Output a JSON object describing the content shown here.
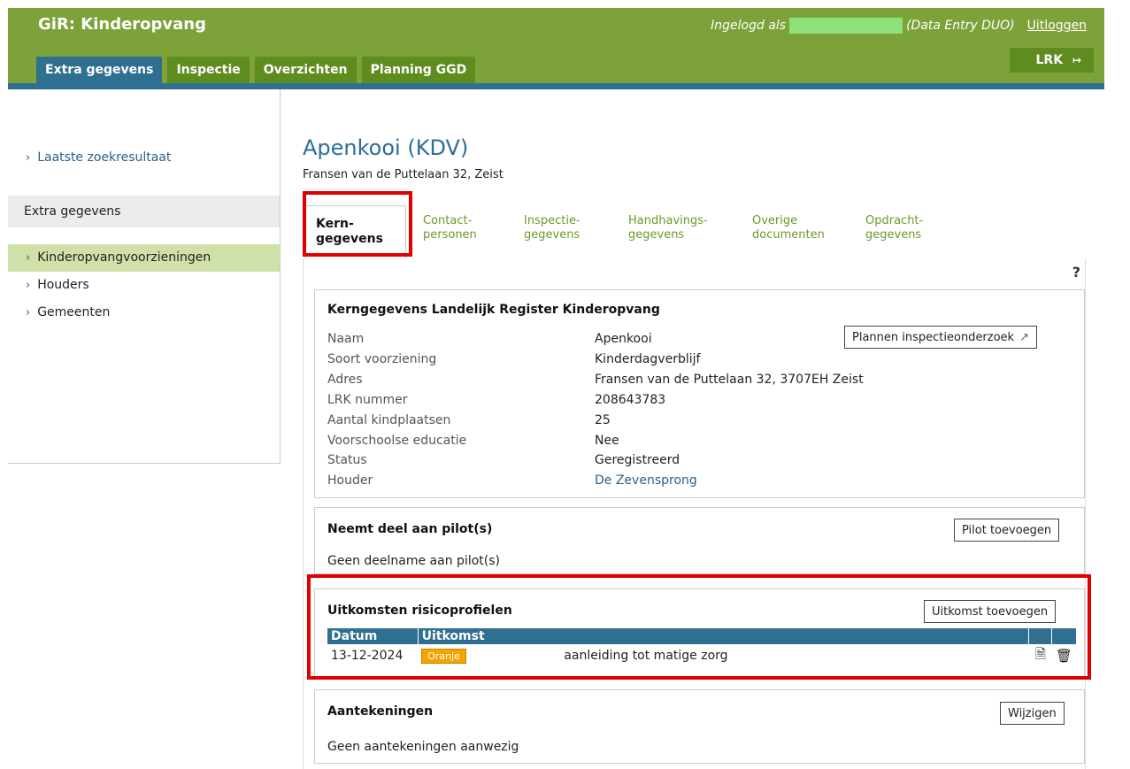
{
  "caption": "Schermafdruk van de tabbladen Kerngegevens met uitkomsten risicoprofielen in GiR Kinderopvang",
  "header": {
    "app_title": "GiR: Kinderopvang",
    "logged_in_prefix": "Ingelogd als",
    "role": "(Data Entry DUO)",
    "logout": "Uitloggen",
    "lrk_button": "LRK"
  },
  "nav_tabs": [
    {
      "label": "Extra gegevens",
      "active": true
    },
    {
      "label": "Inspectie"
    },
    {
      "label": "Overzichten"
    },
    {
      "label": "Planning GGD"
    }
  ],
  "sidebar": {
    "last_search": "Laatste zoekresultaat",
    "section": "Extra gegevens",
    "items": [
      {
        "label": "Kinderopvangvoorzieningen",
        "active": true
      },
      {
        "label": "Houders"
      },
      {
        "label": "Gemeenten"
      }
    ]
  },
  "page": {
    "title": "Apenkooi (KDV)",
    "subtitle": "Fransen van de Puttelaan 32, Zeist"
  },
  "content_tabs": [
    {
      "line1": "Kern-",
      "line2": "gegevens",
      "active": true
    },
    {
      "line1": "Contact-",
      "line2": "personen"
    },
    {
      "line1": "Inspectie-",
      "line2": "gegevens"
    },
    {
      "line1": "Handhavings-",
      "line2": "gegevens"
    },
    {
      "line1": "Overige",
      "line2": "documenten"
    },
    {
      "line1": "Opdracht-",
      "line2": "gegevens"
    }
  ],
  "help": "?",
  "kerngegevens": {
    "heading": "Kerngegevens Landelijk Register Kinderopvang",
    "plan_button": "Plannen inspectieonderzoek",
    "fields": [
      {
        "label": "Naam",
        "value": "Apenkooi"
      },
      {
        "label": "Soort voorziening",
        "value": "Kinderdagverblijf"
      },
      {
        "label": "Adres",
        "value": "Fransen van de Puttelaan 32, 3707EH Zeist"
      },
      {
        "label": "LRK nummer",
        "value": "208643783"
      },
      {
        "label": "Aantal kindplaatsen",
        "value": "25"
      },
      {
        "label": "Voorschoolse educatie",
        "value": "Nee"
      },
      {
        "label": "Status",
        "value": "Geregistreerd"
      },
      {
        "label": "Houder",
        "value": "De Zevensprong"
      }
    ]
  },
  "pilots": {
    "heading": "Neemt deel aan pilot(s)",
    "button": "Pilot toevoegen",
    "empty": "Geen deelname aan pilot(s)"
  },
  "risico": {
    "heading": "Uitkomsten risicoprofielen",
    "button": "Uitkomst toevoegen",
    "columns": [
      "Datum",
      "Uitkomst"
    ],
    "rows": [
      {
        "datum": "13-12-2024",
        "badge": "Oranje",
        "omschrijving": "aanleiding tot matige zorg"
      }
    ],
    "badge_color": "#f5a300"
  },
  "aantekeningen": {
    "heading": "Aantekeningen",
    "button": "Wijzigen",
    "empty": "Geen aantekeningen aanwezig"
  },
  "colors": {
    "brand_green": "#7da23a",
    "accent_blue": "#2f6f8f",
    "highlight_red": "#e00000"
  }
}
